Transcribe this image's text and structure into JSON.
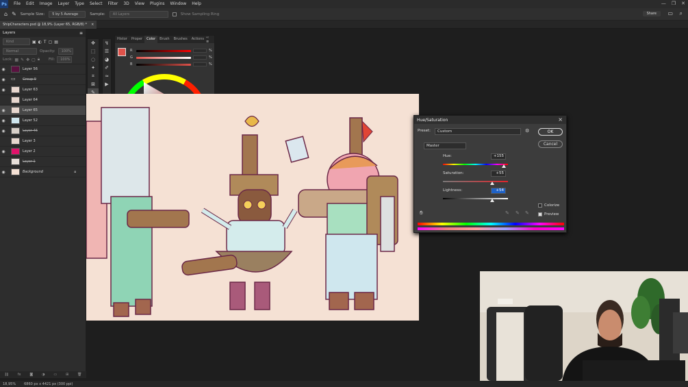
{
  "menubar": {
    "logo": "Ps",
    "items": [
      "File",
      "Edit",
      "Image",
      "Layer",
      "Type",
      "Select",
      "Filter",
      "3D",
      "View",
      "Plugins",
      "Window",
      "Help"
    ]
  },
  "options": {
    "sample_size_label": "Sample Size:",
    "sample_size_value": "5 by 5 Average",
    "sample_label": "Sample:",
    "sample_value": "All Layers",
    "show_ring_label": "Show Sampling Ring",
    "share_label": "Share"
  },
  "document_tab": {
    "title": "ShipCharacters.psd @ 18,9% (Layer 65, RGB/8) *",
    "close": "×"
  },
  "layers_panel": {
    "title": "Layers",
    "search_placeholder": "Kind",
    "blend_mode": "Normal",
    "opacity_label": "Opacity:",
    "opacity_value": "100%",
    "lock_label": "Lock:",
    "fill_label": "Fill:",
    "fill_value": "100%",
    "layers": [
      {
        "name": "Layer 56",
        "visible": true,
        "thumb": "#5a1240",
        "style": ""
      },
      {
        "name": "Group 9",
        "visible": true,
        "thumb": "folder",
        "style": "struck"
      },
      {
        "name": "Layer 63",
        "visible": true,
        "thumb": "#e8d7cf",
        "style": ""
      },
      {
        "name": "Layer 64",
        "visible": false,
        "thumb": "#e8d7cf",
        "style": ""
      },
      {
        "name": "Layer 65",
        "visible": true,
        "thumb": "#e8d7cf",
        "style": "",
        "selected": true
      },
      {
        "name": "Layer 52",
        "visible": true,
        "thumb": "#cfe6ee",
        "style": ""
      },
      {
        "name": "Layer 46",
        "visible": true,
        "thumb": "#d8cfc8",
        "style": "struck"
      },
      {
        "name": "Layer 3",
        "visible": false,
        "thumb": "#e8d7cf",
        "style": ""
      },
      {
        "name": "Layer 2",
        "visible": true,
        "thumb": "#e0126a",
        "style": ""
      },
      {
        "name": "Layer 1",
        "visible": false,
        "thumb": "#e8e0da",
        "style": "struck"
      },
      {
        "name": "Background",
        "visible": true,
        "thumb": "#f5e1d4",
        "style": "ital",
        "locked": true
      }
    ]
  },
  "color_panel": {
    "tabs": [
      "Histor",
      "Proper",
      "Color",
      "Brush",
      "Brushes",
      "Actions"
    ],
    "active_tab": "Color",
    "slider_labels": [
      "R",
      "G",
      "B"
    ],
    "slider_values": [
      "",
      "",
      ""
    ],
    "percent": "%",
    "foreground": "#e0524a",
    "background": "#ffffff"
  },
  "hue_sat_dialog": {
    "title": "Hue/Saturation",
    "close": "×",
    "preset_label": "Preset:",
    "preset_value": "Custom",
    "channel_value": "Master",
    "ok_label": "OK",
    "cancel_label": "Cancel",
    "hue_label": "Hue:",
    "hue_value": "+155",
    "saturation_label": "Saturation:",
    "saturation_value": "+55",
    "lightness_label": "Lightness:",
    "lightness_value": "+54",
    "colorize_label": "Colorize",
    "preview_label": "Preview",
    "colorize_checked": false,
    "preview_checked": true
  },
  "statusbar": {
    "zoom": "18,95%",
    "dimensions": "6860 px x 4421 px (300 ppi)"
  },
  "colors": {
    "accent": "#1473e6",
    "canvas_bg": "#f5e1d4",
    "ok_button": "#1f62c6"
  }
}
